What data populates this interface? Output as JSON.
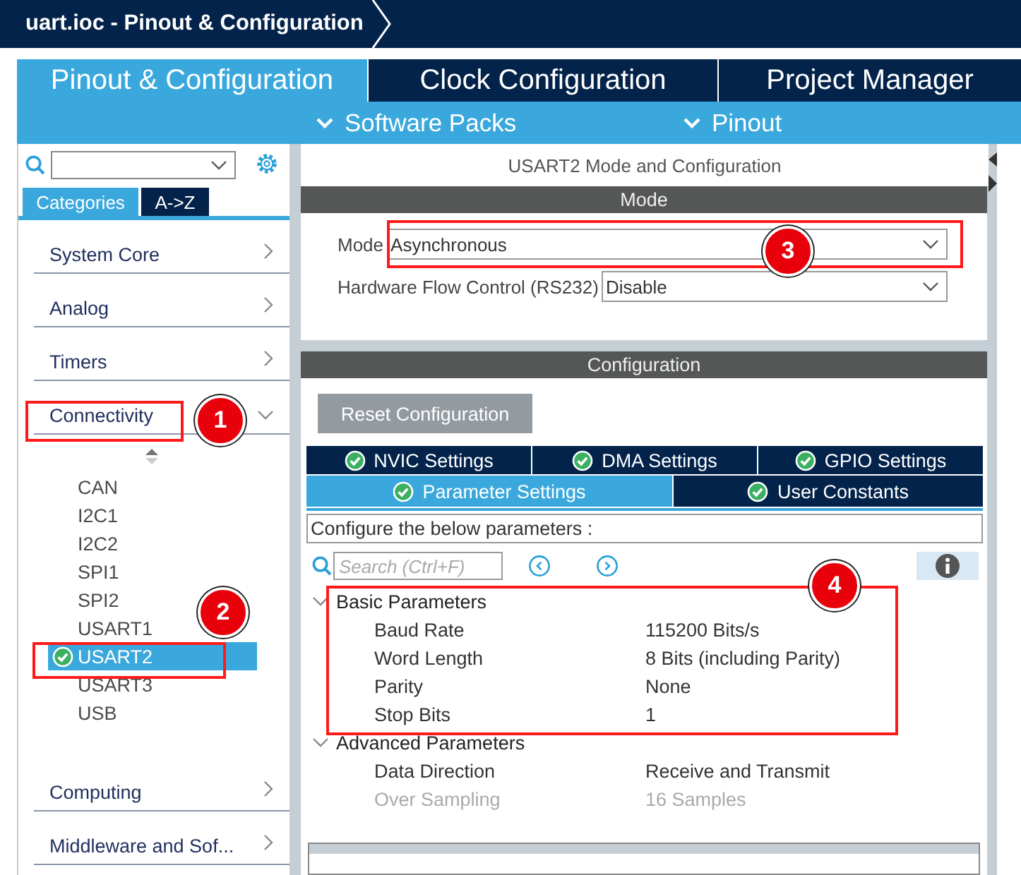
{
  "window": {
    "title": "uart.ioc - Pinout & Configuration"
  },
  "main_tabs": [
    {
      "label": "Pinout & Configuration",
      "selected": true
    },
    {
      "label": "Clock Configuration",
      "selected": false
    },
    {
      "label": "Project Manager",
      "selected": false
    }
  ],
  "sub_menus": [
    {
      "label": "Software Packs"
    },
    {
      "label": "Pinout"
    }
  ],
  "sidebar": {
    "view_tabs": [
      {
        "label": "Categories",
        "selected": true
      },
      {
        "label": "A->Z",
        "selected": false
      }
    ],
    "categories": [
      {
        "label": "System Core",
        "expanded": false
      },
      {
        "label": "Analog",
        "expanded": false
      },
      {
        "label": "Timers",
        "expanded": false
      },
      {
        "label": "Connectivity",
        "expanded": true,
        "children": [
          {
            "label": "CAN",
            "selected": false,
            "configured": false
          },
          {
            "label": "I2C1",
            "selected": false,
            "configured": false
          },
          {
            "label": "I2C2",
            "selected": false,
            "configured": false
          },
          {
            "label": "SPI1",
            "selected": false,
            "configured": false
          },
          {
            "label": "SPI2",
            "selected": false,
            "configured": false
          },
          {
            "label": "USART1",
            "selected": false,
            "configured": false
          },
          {
            "label": "USART2",
            "selected": true,
            "configured": true
          },
          {
            "label": "USART3",
            "selected": false,
            "configured": false
          },
          {
            "label": "USB",
            "selected": false,
            "configured": false
          }
        ]
      },
      {
        "label": "Computing",
        "expanded": false
      },
      {
        "label": "Middleware and Sof...",
        "expanded": false
      }
    ]
  },
  "panel": {
    "title": "USART2 Mode and Configuration",
    "mode_section": {
      "heading": "Mode",
      "fields": [
        {
          "label": "Mode",
          "value": "Asynchronous"
        },
        {
          "label": "Hardware Flow Control (RS232)",
          "value": "Disable"
        }
      ]
    },
    "configuration": {
      "heading": "Configuration",
      "reset_button": "Reset Configuration",
      "tab_rows": [
        {
          "tabs": [
            {
              "label": "NVIC Settings",
              "selected": false
            },
            {
              "label": "DMA Settings",
              "selected": false
            },
            {
              "label": "GPIO Settings",
              "selected": false
            }
          ]
        },
        {
          "tabs": [
            {
              "label": "Parameter Settings",
              "selected": true
            },
            {
              "label": "User Constants",
              "selected": false
            }
          ]
        }
      ],
      "description": "Configure the below parameters :",
      "search": {
        "placeholder": "Search (Ctrl+F)"
      },
      "groups": [
        {
          "label": "Basic Parameters",
          "expanded": true,
          "parameters": [
            {
              "name": "Baud Rate",
              "value": "115200 Bits/s",
              "disabled": false
            },
            {
              "name": "Word Length",
              "value": "8 Bits (including Parity)",
              "disabled": false
            },
            {
              "name": "Parity",
              "value": "None",
              "disabled": false
            },
            {
              "name": "Stop Bits",
              "value": "1",
              "disabled": false
            }
          ]
        },
        {
          "label": "Advanced Parameters",
          "expanded": true,
          "parameters": [
            {
              "name": "Data Direction",
              "value": "Receive and Transmit",
              "disabled": false
            },
            {
              "name": "Over Sampling",
              "value": "16 Samples",
              "disabled": true
            }
          ]
        }
      ]
    }
  },
  "annotations": [
    {
      "number": "1"
    },
    {
      "number": "2"
    },
    {
      "number": "3"
    },
    {
      "number": "4"
    }
  ]
}
